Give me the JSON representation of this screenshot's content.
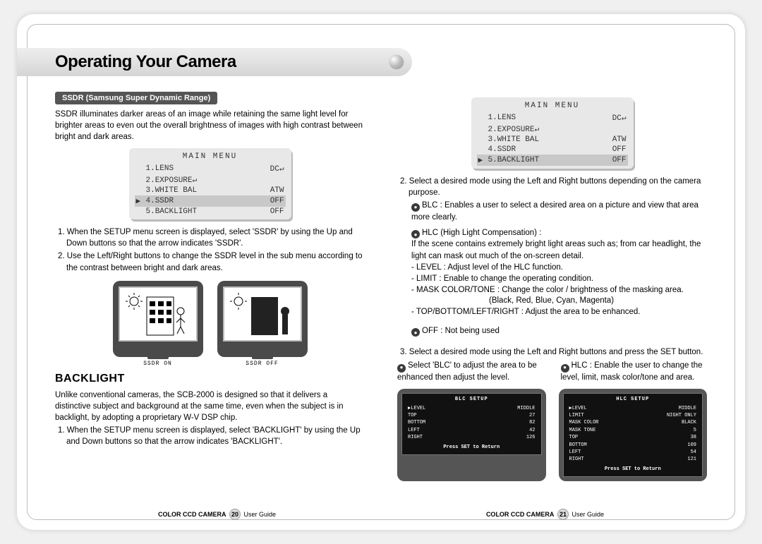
{
  "chapter": {
    "title": "Operating Your Camera"
  },
  "ssdr": {
    "badge": "SSDR (Samsung Super Dynamic Range)",
    "intro": "SSDR illuminates darker areas of an image while retaining the same light level for brighter areas to even out the overall brightness of images with high contrast between bright and dark areas.",
    "menu_title": "MAIN MENU",
    "menu": [
      {
        "ptr": "",
        "label": "1.LENS",
        "val": "DC↵"
      },
      {
        "ptr": "",
        "label": "2.EXPOSURE↵",
        "val": ""
      },
      {
        "ptr": "",
        "label": "3.WHITE BAL",
        "val": "ATW"
      },
      {
        "ptr": "▶",
        "label": "4.SSDR",
        "val": "OFF",
        "sel": true
      },
      {
        "ptr": "",
        "label": "5.BACKLIGHT",
        "val": "OFF"
      }
    ],
    "steps": [
      "1. When the SETUP menu screen is displayed, select 'SSDR' by using the Up and Down buttons so that the arrow indicates 'SSDR'.",
      "2. Use the Left/Right buttons to change the SSDR level in the sub menu according to the contrast between bright and dark areas."
    ],
    "cap_on": "SSDR ON",
    "cap_off": "SSDR OFF"
  },
  "backlight": {
    "title": "BACKLIGHT",
    "intro": "Unlike conventional cameras, the SCB-2000 is designed so that it delivers a distinctive subject and background at the same time, even when the subject is in backlight, by adopting a proprietary W-V DSP chip.",
    "step1": "1. When the SETUP menu screen is displayed, select 'BACKLIGHT' by using the Up and Down buttons so that the arrow indicates 'BACKLIGHT'."
  },
  "right": {
    "menu_title": "MAIN MENU",
    "menu": [
      {
        "ptr": "",
        "label": "1.LENS",
        "val": "DC↵"
      },
      {
        "ptr": "",
        "label": "2.EXPOSURE↵",
        "val": ""
      },
      {
        "ptr": "",
        "label": "3.WHITE BAL",
        "val": "ATW"
      },
      {
        "ptr": "",
        "label": "4.SSDR",
        "val": "OFF"
      },
      {
        "ptr": "▶",
        "label": "5.BACKLIGHT",
        "val": "OFF",
        "sel": true
      }
    ],
    "step2": "2. Select a desired mode using the Left and Right buttons depending on the camera purpose.",
    "blc_lead": "BLC : Enables a user to select a desired area on a picture and view that area more clearly.",
    "hlc_lead": "HLC (High Light Compensation) :",
    "hlc_body": "If the scene contains extremely bright light areas such as; from car headlight, the light can mask out much of the on-screen detail.",
    "hlc_items": [
      "- LEVEL : Adjust level of the HLC function.",
      "- LIMIT : Enable to change the operating condition.",
      "- MASK COLOR/TONE : Change the color / brightness of the masking area."
    ],
    "hlc_colors": "(Black, Red, Blue, Cyan, Magenta)",
    "hlc_tblr": "- TOP/BOTTOM/LEFT/RIGHT : Adjust the area to be enhanced.",
    "off_lead": "OFF : Not being used",
    "step3": "3. Select a desired mode using the Left and Right buttons and press the SET button.",
    "split_l_lead": "Select  'BLC' to adjust the area to be enhanced then adjust the level.",
    "split_r_lead": "HLC : Enable the user to change the level, limit, mask color/tone and area.",
    "blc_setup_title": "BLC SETUP",
    "blc_setup": [
      [
        "▶LEVEL",
        "MIDDLE"
      ],
      [
        "  TOP",
        "27"
      ],
      [
        "  BOTTOM",
        "82"
      ],
      [
        "  LEFT",
        "42"
      ],
      [
        "  RIGHT",
        "126"
      ]
    ],
    "blc_ret": "Press SET to Return",
    "hlc_setup_title": "HLC SETUP",
    "hlc_setup": [
      [
        "▶LEVEL",
        "MIDDLE"
      ],
      [
        "  LIMIT",
        "NIGHT ONLY"
      ],
      [
        "  MASK COLOR",
        "BLACK"
      ],
      [
        "  MASK TONE",
        "5"
      ],
      [
        "  TOP",
        "38"
      ],
      [
        "  BOTTOM",
        "109"
      ],
      [
        "  LEFT",
        "54"
      ],
      [
        "  RIGHT",
        "121"
      ]
    ],
    "hlc_ret": "Press SET to Return"
  },
  "footer": {
    "brand": "COLOR CCD CAMERA",
    "guide": "User Guide",
    "p20": "20",
    "p21": "21"
  }
}
